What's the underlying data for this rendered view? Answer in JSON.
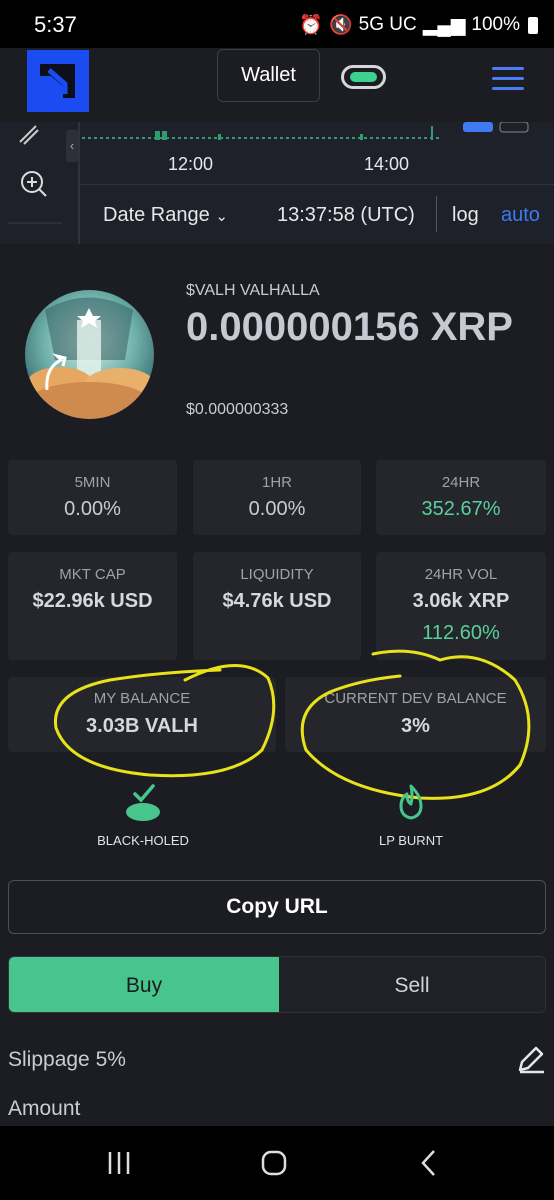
{
  "status_bar": {
    "time": "5:37",
    "network": "5G UC",
    "battery": "100%"
  },
  "nav": {
    "wallet_label": "Wallet"
  },
  "chart_strip": {
    "x_ticks": [
      "12:00",
      "14:00"
    ],
    "date_range_label": "Date Range",
    "timestamp": "13:37:58 (UTC)",
    "log_label": "log",
    "auto_label": "auto"
  },
  "token": {
    "name": "$VALH VALHALLA",
    "price": "0.000000156 XRP",
    "price_usd": "$0.000000333"
  },
  "stats_row1": [
    {
      "label": "5MIN",
      "value": "0.00%"
    },
    {
      "label": "1HR",
      "value": "0.00%"
    },
    {
      "label": "24HR",
      "value": "352.67%"
    }
  ],
  "stats_row2": [
    {
      "label": "MKT CAP",
      "value": "$22.96k USD"
    },
    {
      "label": "LIQUIDITY",
      "value": "$4.76k USD"
    },
    {
      "label": "24HR VOL",
      "value": "3.06k XRP",
      "sub": "112.60%"
    }
  ],
  "stats_row3": [
    {
      "label": "MY BALANCE",
      "value": "3.03B VALH"
    },
    {
      "label": "CURRENT DEV BALANCE",
      "value": "3%"
    }
  ],
  "badges": [
    {
      "label": "BLACK-HOLED",
      "icon": "check-disc-icon"
    },
    {
      "label": "LP BURNT",
      "icon": "flame-icon"
    }
  ],
  "actions": {
    "copy_url": "Copy URL",
    "buy": "Buy",
    "sell": "Sell",
    "slippage": "Slippage 5%",
    "amount": "Amount"
  },
  "colors": {
    "accent_blue": "#1a4cf2",
    "green": "#47c58c",
    "highlight_yellow": "#e8e21a"
  }
}
